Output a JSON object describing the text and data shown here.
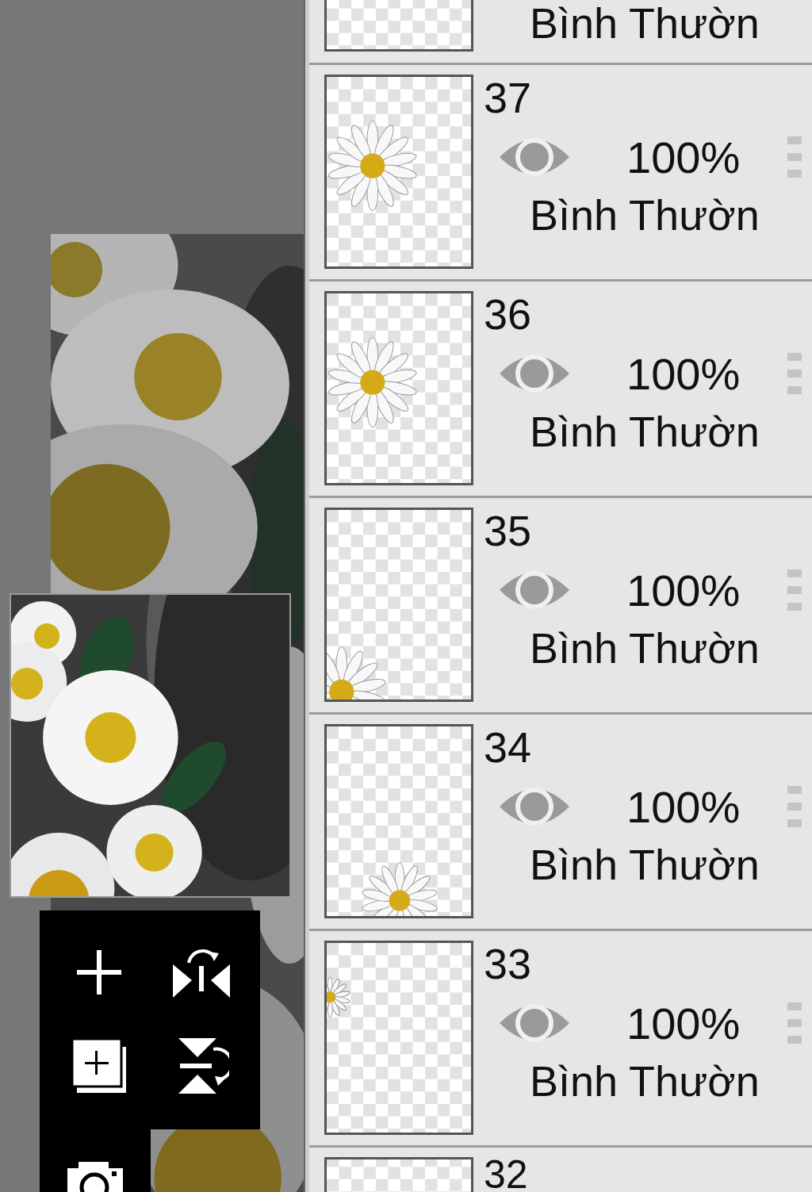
{
  "layers": [
    {
      "blend_mode": "Bình Thườn"
    },
    {
      "number": "37",
      "visible": true,
      "opacity": "100%",
      "blend_mode": "Bình Thườn"
    },
    {
      "number": "36",
      "visible": true,
      "opacity": "100%",
      "blend_mode": "Bình Thườn"
    },
    {
      "number": "35",
      "visible": true,
      "opacity": "100%",
      "blend_mode": "Bình Thườn"
    },
    {
      "number": "34",
      "visible": true,
      "opacity": "100%",
      "blend_mode": "Bình Thườn"
    },
    {
      "number": "33",
      "visible": true,
      "opacity": "100%",
      "blend_mode": "Bình Thườn"
    },
    {
      "number": "32"
    }
  ]
}
